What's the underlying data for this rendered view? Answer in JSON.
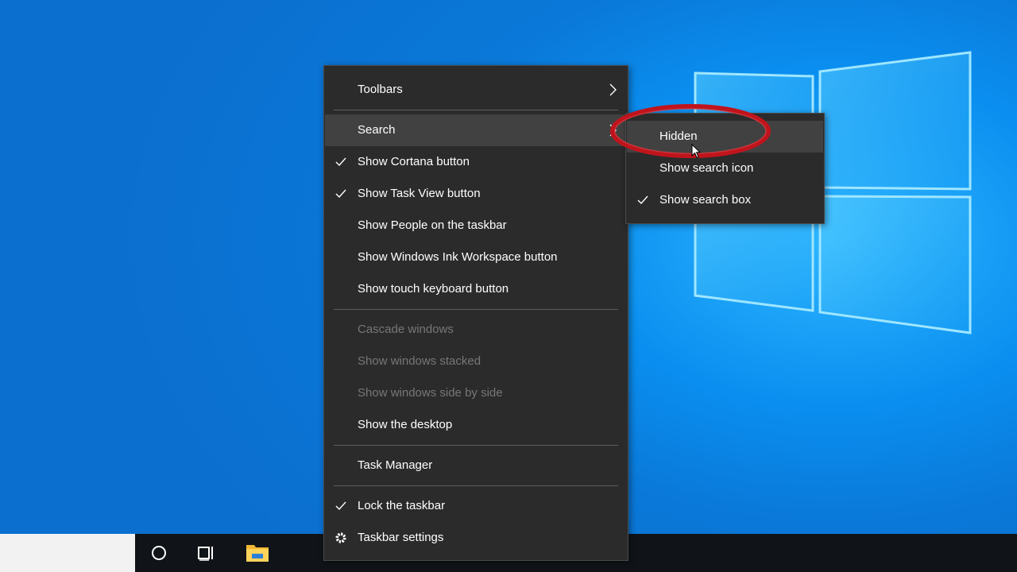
{
  "menu": {
    "items": [
      {
        "label": "Toolbars",
        "checked": false,
        "disabled": false,
        "submenu": true
      },
      {
        "label": "Search",
        "checked": false,
        "disabled": false,
        "submenu": true,
        "highlighted": true
      },
      {
        "label": "Show Cortana button",
        "checked": true,
        "disabled": false
      },
      {
        "label": "Show Task View button",
        "checked": true,
        "disabled": false
      },
      {
        "label": "Show People on the taskbar",
        "checked": false,
        "disabled": false
      },
      {
        "label": "Show Windows Ink Workspace button",
        "checked": false,
        "disabled": false
      },
      {
        "label": "Show touch keyboard button",
        "checked": false,
        "disabled": false
      },
      {
        "label": "Cascade windows",
        "checked": false,
        "disabled": true
      },
      {
        "label": "Show windows stacked",
        "checked": false,
        "disabled": true
      },
      {
        "label": "Show windows side by side",
        "checked": false,
        "disabled": true
      },
      {
        "label": "Show the desktop",
        "checked": false,
        "disabled": false
      },
      {
        "label": "Task Manager",
        "checked": false,
        "disabled": false
      },
      {
        "label": "Lock the taskbar",
        "checked": true,
        "disabled": false
      },
      {
        "label": "Taskbar settings",
        "icon": "gear-icon",
        "disabled": false
      }
    ]
  },
  "submenu": {
    "items": [
      {
        "label": "Hidden",
        "checked": false,
        "highlighted": true
      },
      {
        "label": "Show search icon",
        "checked": false
      },
      {
        "label": "Show search box",
        "checked": true
      }
    ]
  },
  "taskbar": {
    "icons": [
      "cortana-icon",
      "task-view-icon",
      "file-explorer-icon"
    ]
  },
  "colors": {
    "menu_bg": "#2b2b2b",
    "highlight": "#414141",
    "disabled_text": "#777777",
    "annotation": "#c0141c",
    "desktop_blue": "#0a78d8"
  }
}
